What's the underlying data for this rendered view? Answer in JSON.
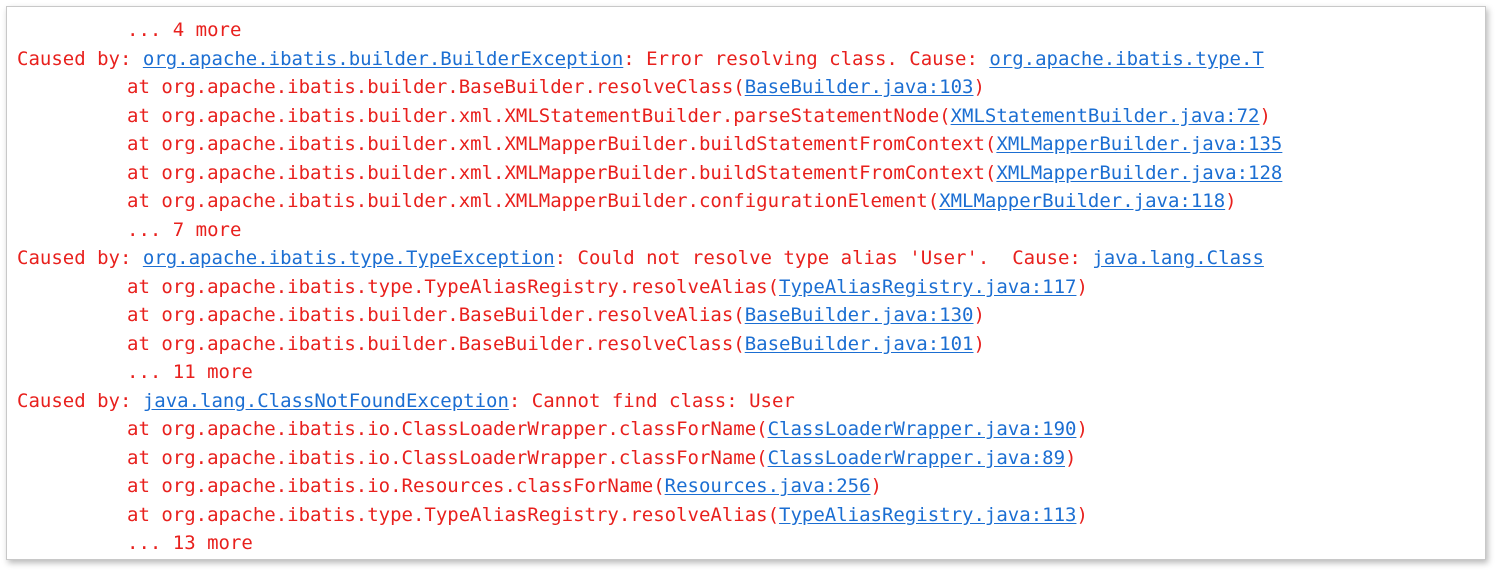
{
  "colors": {
    "error_text": "#e8201d",
    "link_text": "#1b6ed2",
    "background": "#ffffff",
    "frame_border": "#c8c8c8"
  },
  "lines": [
    {
      "indent": true,
      "prefix": "... 4 more",
      "link": "",
      "suffix": ""
    },
    {
      "indent": false,
      "prefix": "Caused by: ",
      "link": "org.apache.ibatis.builder.BuilderException",
      "suffix": ": Error resolving class. Cause: ",
      "link2": "org.apache.ibatis.type.T"
    },
    {
      "indent": true,
      "prefix": "at org.apache.ibatis.builder.BaseBuilder.resolveClass(",
      "link": "BaseBuilder.java:103",
      "suffix": ")"
    },
    {
      "indent": true,
      "prefix": "at org.apache.ibatis.builder.xml.XMLStatementBuilder.parseStatementNode(",
      "link": "XMLStatementBuilder.java:72",
      "suffix": ")"
    },
    {
      "indent": true,
      "prefix": "at org.apache.ibatis.builder.xml.XMLMapperBuilder.buildStatementFromContext(",
      "link": "XMLMapperBuilder.java:135",
      "suffix": ""
    },
    {
      "indent": true,
      "prefix": "at org.apache.ibatis.builder.xml.XMLMapperBuilder.buildStatementFromContext(",
      "link": "XMLMapperBuilder.java:128",
      "suffix": ""
    },
    {
      "indent": true,
      "prefix": "at org.apache.ibatis.builder.xml.XMLMapperBuilder.configurationElement(",
      "link": "XMLMapperBuilder.java:118",
      "suffix": ")"
    },
    {
      "indent": true,
      "prefix": "... 7 more",
      "link": "",
      "suffix": ""
    },
    {
      "indent": false,
      "prefix": "Caused by: ",
      "link": "org.apache.ibatis.type.TypeException",
      "suffix": ": Could not resolve type alias 'User'.  Cause: ",
      "link2": "java.lang.Class"
    },
    {
      "indent": true,
      "prefix": "at org.apache.ibatis.type.TypeAliasRegistry.resolveAlias(",
      "link": "TypeAliasRegistry.java:117",
      "suffix": ")"
    },
    {
      "indent": true,
      "prefix": "at org.apache.ibatis.builder.BaseBuilder.resolveAlias(",
      "link": "BaseBuilder.java:130",
      "suffix": ")"
    },
    {
      "indent": true,
      "prefix": "at org.apache.ibatis.builder.BaseBuilder.resolveClass(",
      "link": "BaseBuilder.java:101",
      "suffix": ")"
    },
    {
      "indent": true,
      "prefix": "... 11 more",
      "link": "",
      "suffix": ""
    },
    {
      "indent": false,
      "prefix": "Caused by: ",
      "link": "java.lang.ClassNotFoundException",
      "suffix": ": Cannot find class: User"
    },
    {
      "indent": true,
      "prefix": "at org.apache.ibatis.io.ClassLoaderWrapper.classForName(",
      "link": "ClassLoaderWrapper.java:190",
      "suffix": ")"
    },
    {
      "indent": true,
      "prefix": "at org.apache.ibatis.io.ClassLoaderWrapper.classForName(",
      "link": "ClassLoaderWrapper.java:89",
      "suffix": ")"
    },
    {
      "indent": true,
      "prefix": "at org.apache.ibatis.io.Resources.classForName(",
      "link": "Resources.java:256",
      "suffix": ")"
    },
    {
      "indent": true,
      "prefix": "at org.apache.ibatis.type.TypeAliasRegistry.resolveAlias(",
      "link": "TypeAliasRegistry.java:113",
      "suffix": ")"
    },
    {
      "indent": true,
      "prefix": "... 13 more",
      "link": "",
      "suffix": ""
    }
  ]
}
